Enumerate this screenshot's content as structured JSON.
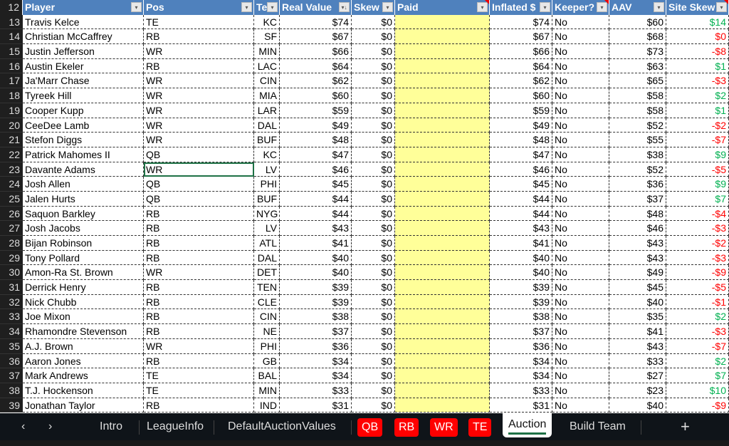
{
  "columns": [
    "Player",
    "Pos",
    "Te",
    "Real Value",
    "Skew",
    "Paid",
    "Inflated $",
    "Keeper?",
    "AAV",
    "Site Skew"
  ],
  "header_row": "12",
  "rows": [
    [
      "13",
      "Travis Kelce",
      "TE",
      "KC",
      "$74",
      "$0",
      "",
      "$74",
      "No",
      "$60",
      "$14"
    ],
    [
      "14",
      "Christian McCaffrey",
      "RB",
      "SF",
      "$67",
      "$0",
      "",
      "$67",
      "No",
      "$68",
      "$0"
    ],
    [
      "15",
      "Justin Jefferson",
      "WR",
      "MIN",
      "$66",
      "$0",
      "",
      "$66",
      "No",
      "$73",
      "-$8"
    ],
    [
      "16",
      "Austin Ekeler",
      "RB",
      "LAC",
      "$64",
      "$0",
      "",
      "$64",
      "No",
      "$63",
      "$1"
    ],
    [
      "17",
      "Ja'Marr Chase",
      "WR",
      "CIN",
      "$62",
      "$0",
      "",
      "$62",
      "No",
      "$65",
      "-$3"
    ],
    [
      "18",
      "Tyreek Hill",
      "WR",
      "MIA",
      "$60",
      "$0",
      "",
      "$60",
      "No",
      "$58",
      "$2"
    ],
    [
      "19",
      "Cooper Kupp",
      "WR",
      "LAR",
      "$59",
      "$0",
      "",
      "$59",
      "No",
      "$58",
      "$1"
    ],
    [
      "20",
      "CeeDee Lamb",
      "WR",
      "DAL",
      "$49",
      "$0",
      "",
      "$49",
      "No",
      "$52",
      "-$2"
    ],
    [
      "21",
      "Stefon Diggs",
      "WR",
      "BUF",
      "$48",
      "$0",
      "",
      "$48",
      "No",
      "$55",
      "-$7"
    ],
    [
      "22",
      "Patrick Mahomes II",
      "QB",
      "KC",
      "$47",
      "$0",
      "",
      "$47",
      "No",
      "$38",
      "$9"
    ],
    [
      "23",
      "Davante Adams",
      "WR",
      "LV",
      "$46",
      "$0",
      "",
      "$46",
      "No",
      "$52",
      "-$5"
    ],
    [
      "24",
      "Josh Allen",
      "QB",
      "PHI",
      "$45",
      "$0",
      "",
      "$45",
      "No",
      "$36",
      "$9"
    ],
    [
      "25",
      "Jalen Hurts",
      "QB",
      "BUF",
      "$44",
      "$0",
      "",
      "$44",
      "No",
      "$37",
      "$7"
    ],
    [
      "26",
      "Saquon Barkley",
      "RB",
      "NYG",
      "$44",
      "$0",
      "",
      "$44",
      "No",
      "$48",
      "-$4"
    ],
    [
      "27",
      "Josh Jacobs",
      "RB",
      "LV",
      "$43",
      "$0",
      "",
      "$43",
      "No",
      "$46",
      "-$3"
    ],
    [
      "28",
      "Bijan Robinson",
      "RB",
      "ATL",
      "$41",
      "$0",
      "",
      "$41",
      "No",
      "$43",
      "-$2"
    ],
    [
      "29",
      "Tony Pollard",
      "RB",
      "DAL",
      "$40",
      "$0",
      "",
      "$40",
      "No",
      "$43",
      "-$3"
    ],
    [
      "30",
      "Amon-Ra St. Brown",
      "WR",
      "DET",
      "$40",
      "$0",
      "",
      "$40",
      "No",
      "$49",
      "-$9"
    ],
    [
      "31",
      "Derrick Henry",
      "RB",
      "TEN",
      "$39",
      "$0",
      "",
      "$39",
      "No",
      "$45",
      "-$5"
    ],
    [
      "32",
      "Nick Chubb",
      "RB",
      "CLE",
      "$39",
      "$0",
      "",
      "$39",
      "No",
      "$40",
      "-$1"
    ],
    [
      "33",
      "Joe Mixon",
      "RB",
      "CIN",
      "$38",
      "$0",
      "",
      "$38",
      "No",
      "$35",
      "$2"
    ],
    [
      "34",
      "Rhamondre Stevenson",
      "RB",
      "NE",
      "$37",
      "$0",
      "",
      "$37",
      "No",
      "$41",
      "-$3"
    ],
    [
      "35",
      "A.J. Brown",
      "WR",
      "PHI",
      "$36",
      "$0",
      "",
      "$36",
      "No",
      "$43",
      "-$7"
    ],
    [
      "36",
      "Aaron Jones",
      "RB",
      "GB",
      "$34",
      "$0",
      "",
      "$34",
      "No",
      "$33",
      "$2"
    ],
    [
      "37",
      "Mark Andrews",
      "TE",
      "BAL",
      "$34",
      "$0",
      "",
      "$34",
      "No",
      "$27",
      "$7"
    ],
    [
      "38",
      "T.J. Hockenson",
      "TE",
      "MIN",
      "$33",
      "$0",
      "",
      "$33",
      "No",
      "$23",
      "$10"
    ],
    [
      "39",
      "Jonathan Taylor",
      "RB",
      "IND",
      "$31",
      "$0",
      "",
      "$31",
      "No",
      "$40",
      "-$9"
    ]
  ],
  "selected_cell": {
    "row": "23",
    "column": "Pos"
  },
  "tabs": [
    {
      "label": "Intro",
      "style": "normal"
    },
    {
      "label": "LeagueInfo",
      "style": "normal"
    },
    {
      "label": "DefaultAuctionValues",
      "style": "normal"
    },
    {
      "label": "QB",
      "style": "red"
    },
    {
      "label": "RB",
      "style": "red"
    },
    {
      "label": "WR",
      "style": "red"
    },
    {
      "label": "TE",
      "style": "red"
    },
    {
      "label": "Auction",
      "style": "active"
    },
    {
      "label": "Build Team",
      "style": "normal"
    }
  ],
  "add_sheet": "+",
  "colors": {
    "header": "#4f81bd",
    "paid_fill": "#ffff99",
    "positive": "#00b050",
    "negative": "#ff0000",
    "tab_red": "#ff0000"
  }
}
